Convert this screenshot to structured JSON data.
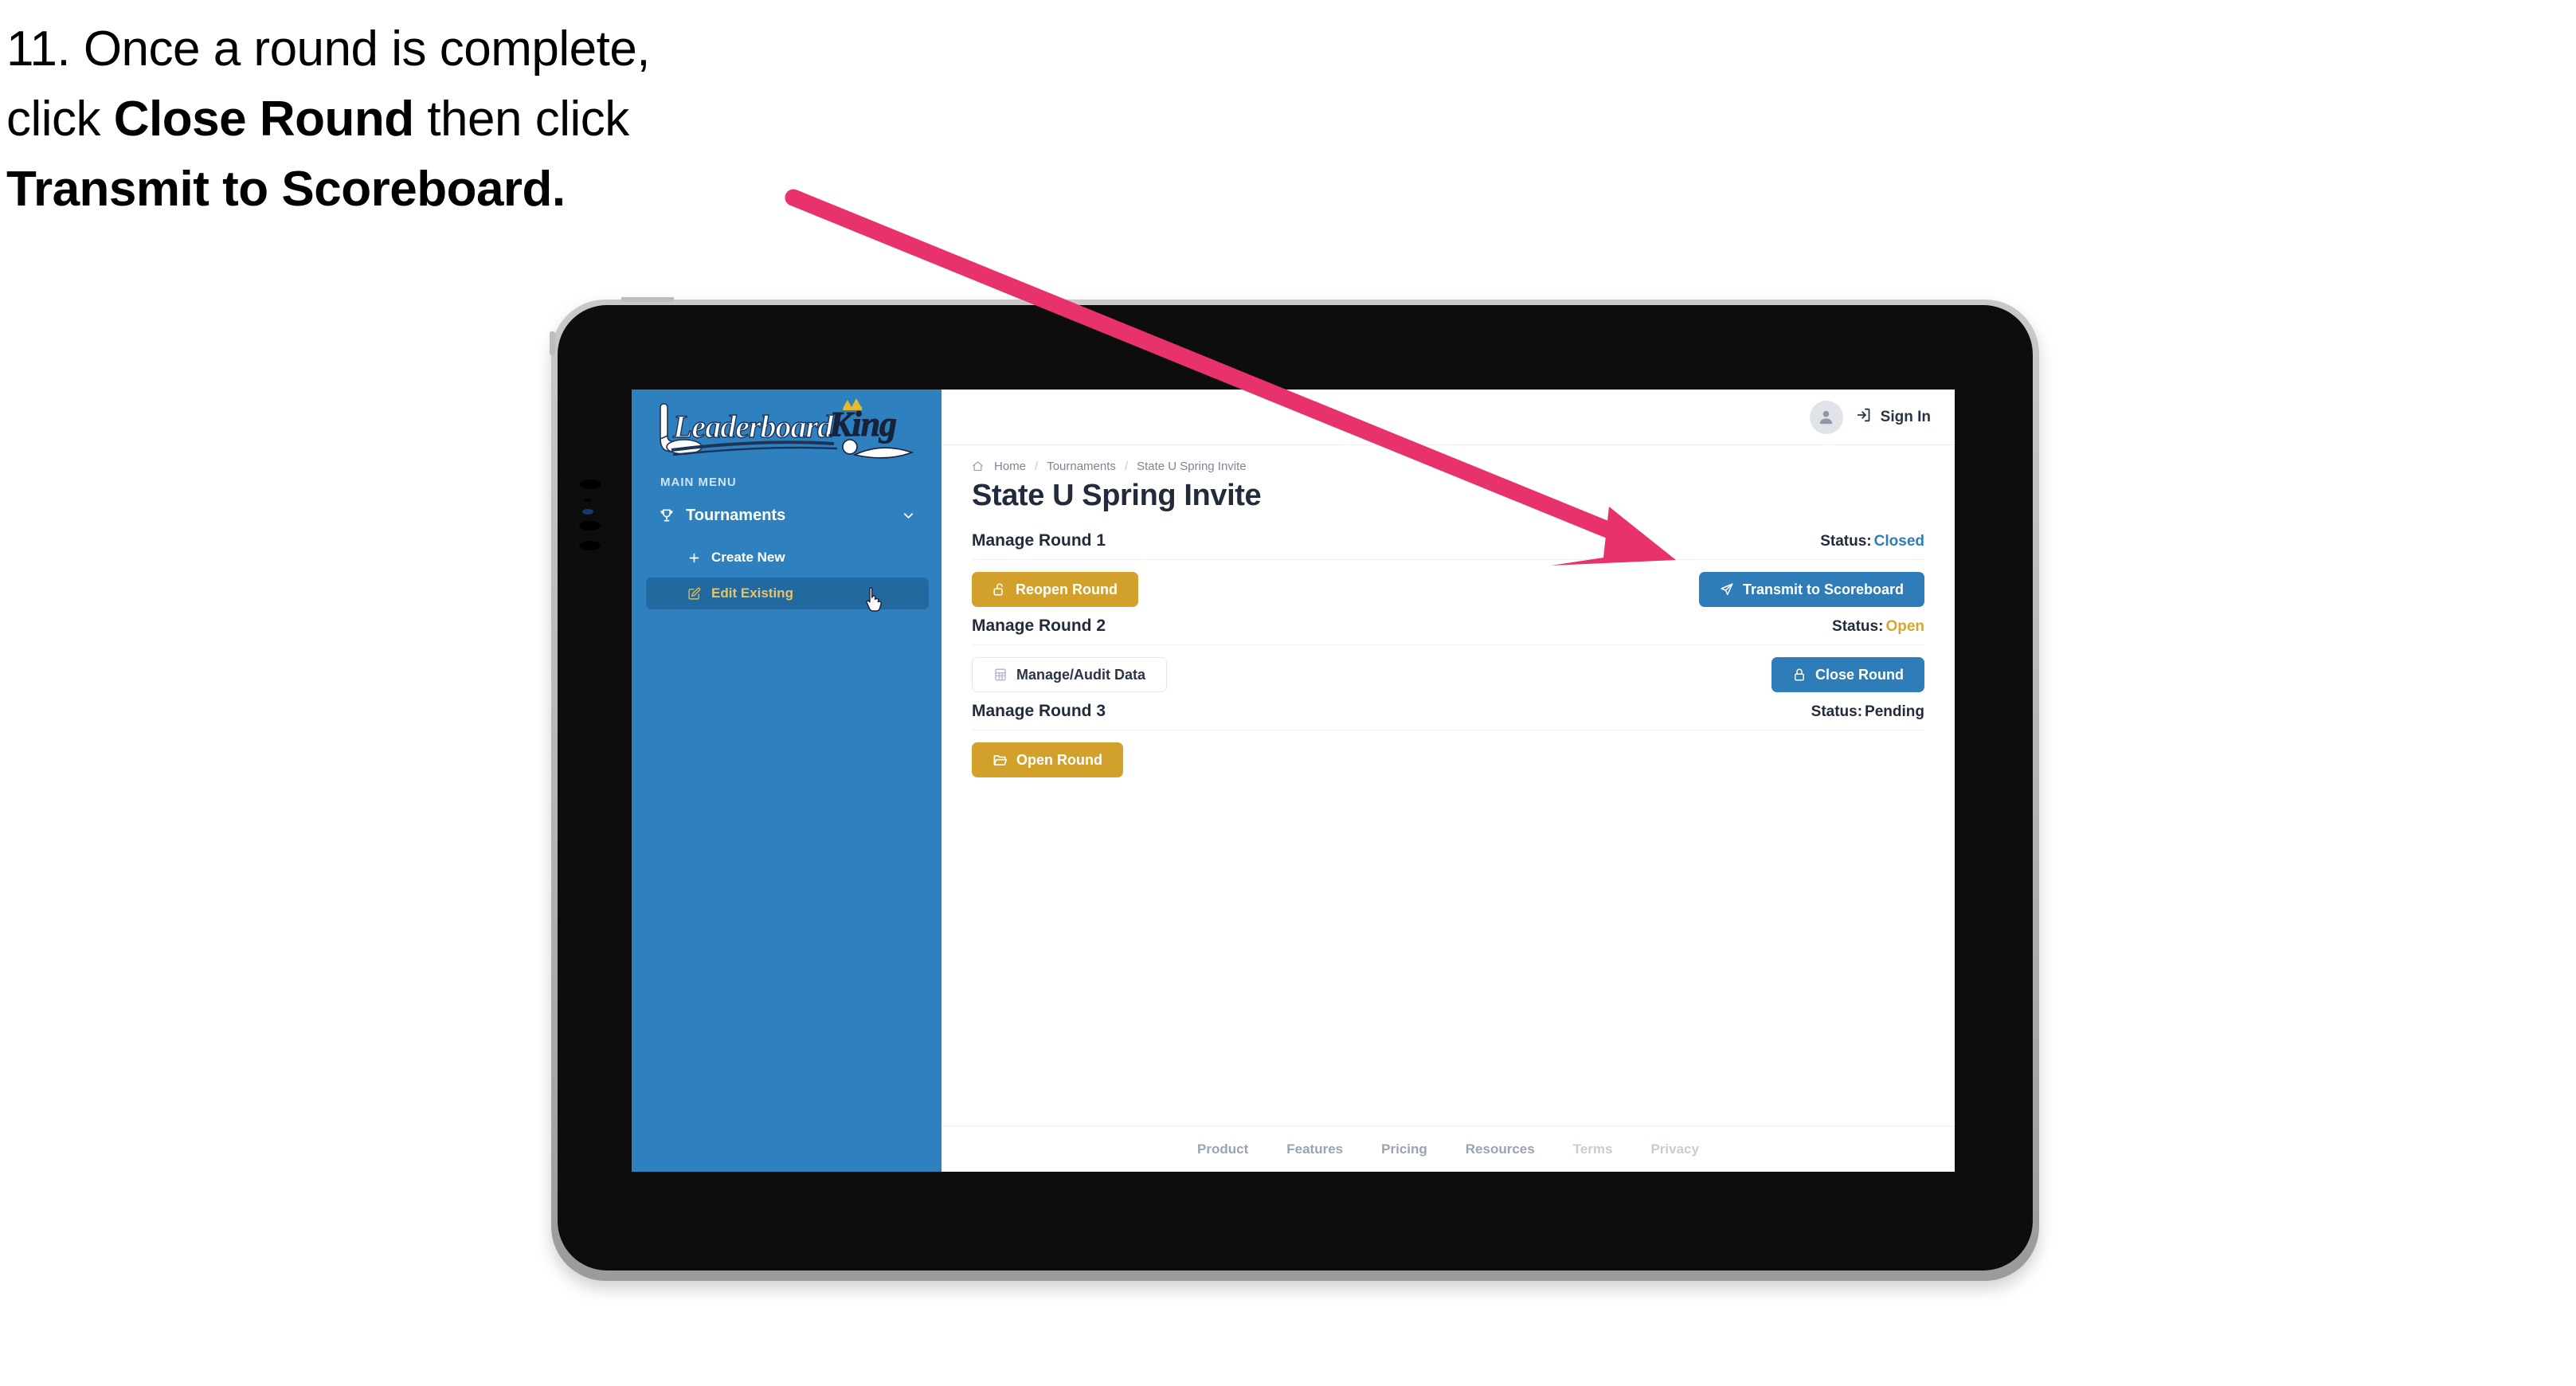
{
  "caption": {
    "line1_plain": "11. Once a round is complete,",
    "line2_pre": "click ",
    "line2_bold": "Close Round",
    "line2_post": " then click",
    "line3_bold": "Transmit to Scoreboard."
  },
  "colors": {
    "sidebar_blue": "#2e80bf",
    "accent_blue": "#2e7cb8",
    "accent_gold": "#d2a12c",
    "status_open": "#d9a52e",
    "status_closed": "#2e7cb8",
    "arrow_pink": "#e8326b",
    "text_dark": "#222b3c"
  },
  "sidebar": {
    "logo_alt": "LeaderboardKing",
    "logo_word1": "Leaderboard",
    "logo_word2": "King",
    "section_label": "MAIN MENU",
    "group": {
      "label": "Tournaments",
      "icon": "trophy-icon",
      "chevron": "chevron-down-icon"
    },
    "items": [
      {
        "label": "Create New",
        "icon": "plus-icon",
        "active": false
      },
      {
        "label": "Edit Existing",
        "icon": "edit-pencil-icon",
        "active": true
      }
    ],
    "cursor": "pointer-hand-cursor"
  },
  "topbar": {
    "avatar_icon": "user-avatar-icon",
    "signin_icon": "login-arrow-icon",
    "signin_label": "Sign In"
  },
  "breadcrumb": {
    "home_icon": "home-icon",
    "items": [
      "Home",
      "Tournaments",
      "State U Spring Invite"
    ],
    "separator": "/"
  },
  "page": {
    "title": "State U Spring Invite"
  },
  "rounds": [
    {
      "name": "Manage Round 1",
      "status_label": "Status:",
      "status_value": "Closed",
      "status_color": "#2e7cb8",
      "left_button": {
        "label": "Reopen Round",
        "style": "gold",
        "icon": "unlock-icon"
      },
      "right_button": {
        "label": "Transmit to Scoreboard",
        "style": "blue",
        "icon": "paper-plane-icon"
      }
    },
    {
      "name": "Manage Round 2",
      "status_label": "Status:",
      "status_value": "Open",
      "status_color": "#d9a52e",
      "left_button": {
        "label": "Manage/Audit Data",
        "style": "ghost",
        "icon": "table-grid-icon"
      },
      "right_button": {
        "label": "Close Round",
        "style": "blue",
        "icon": "lock-icon"
      }
    },
    {
      "name": "Manage Round 3",
      "status_label": "Status:",
      "status_value": "Pending",
      "status_color": "#222b3c",
      "left_button": {
        "label": "Open Round",
        "style": "gold",
        "icon": "folder-open-icon"
      },
      "right_button": null
    }
  ],
  "footer": {
    "links": [
      {
        "label": "Product",
        "muted": false
      },
      {
        "label": "Features",
        "muted": false
      },
      {
        "label": "Pricing",
        "muted": false
      },
      {
        "label": "Resources",
        "muted": false
      },
      {
        "label": "Terms",
        "muted": true
      },
      {
        "label": "Privacy",
        "muted": true
      }
    ]
  }
}
